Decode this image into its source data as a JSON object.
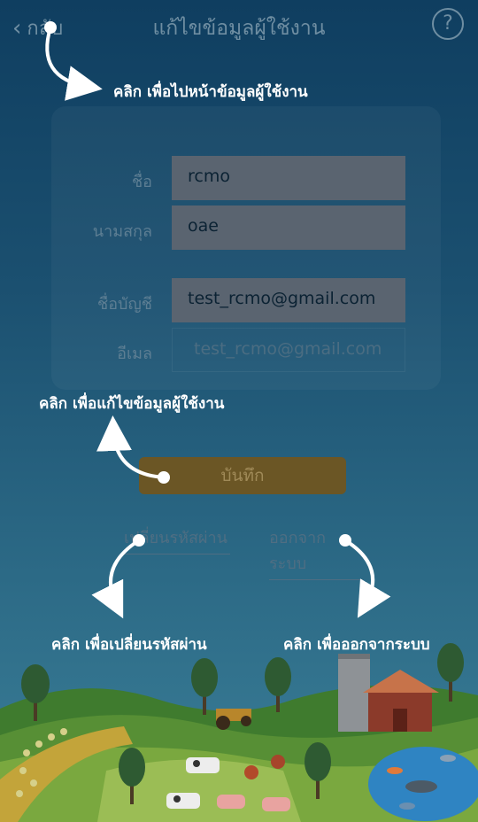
{
  "header": {
    "back_label": "กลับ",
    "title": "แก้ไขข้อมูลผู้ใช้งาน",
    "help_label": "?"
  },
  "form": {
    "first_name_label": "ชื่อ",
    "first_name_value": "rcmo",
    "last_name_label": "นามสกุล",
    "last_name_value": "oae",
    "account_label": "ชื่อบัญชี",
    "account_value": "test_rcmo@gmail.com",
    "email_label": "อีเมล",
    "email_value": "test_rcmo@gmail.com"
  },
  "actions": {
    "save_label": "บันทึก",
    "change_password_label": "เปลี่ยนรหัสผ่าน",
    "logout_label": "ออกจากระบบ"
  },
  "tutorial": {
    "back_hint": "คลิก  เพื่อไปหน้าข้อมูลผู้ใช้งาน",
    "edit_hint": "คลิก  เพื่อแก้ไขข้อมูลผู้ใช้งาน",
    "change_password_hint": "คลิก  เพื่อเปลี่ยนรหัสผ่าน",
    "logout_hint": "คลิก  เพื่อออกจากระบบ"
  },
  "colors": {
    "background_top": "#0f3e60",
    "background_bottom": "#3b7f98",
    "save_button": "#6b5625",
    "field_box": "#5a6470",
    "hint_text": "#ffffff"
  },
  "icons": [
    "chevron-left-icon",
    "help-icon",
    "tractor-icon",
    "barn-icon",
    "tree-icon",
    "fish-icon",
    "cow-icon",
    "pig-icon",
    "rooster-icon"
  ]
}
